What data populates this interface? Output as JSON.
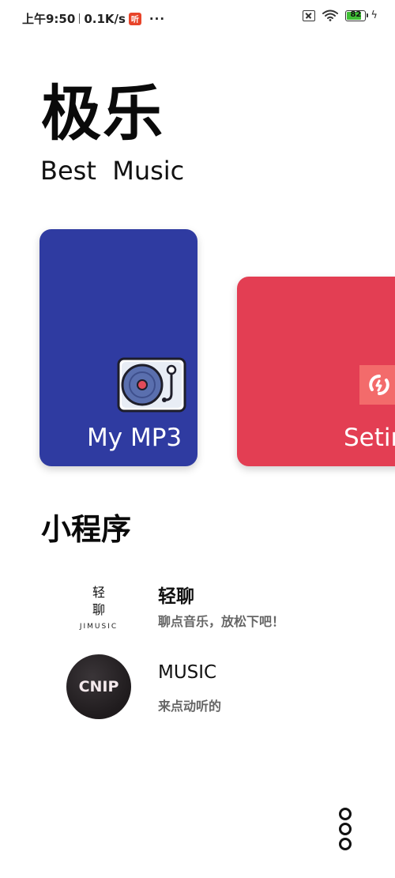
{
  "status_bar": {
    "time": "上午9:50",
    "speed": "0.1K/s",
    "app_icon_glyph": "听",
    "more_dots": "···",
    "battery_level": 82,
    "battery_text": "82",
    "icons": [
      "sim-off-icon",
      "wifi-icon",
      "battery-icon",
      "charging-bolt-icon"
    ]
  },
  "header": {
    "title": "极乐",
    "subtitle": "Best  Music"
  },
  "cards": [
    {
      "label": "My MP3",
      "color": "#2f3ba1",
      "icon": "turntable-icon"
    },
    {
      "label": "Setings",
      "color": "#e33e53",
      "icon": "settings-icon"
    }
  ],
  "section": {
    "title": "小程序"
  },
  "mini_programs": [
    {
      "name": "轻聊",
      "description": "聊点音乐，放松下吧！",
      "logo_line1": "轻",
      "logo_line2": "聊",
      "logo_sub": "JIMUSIC"
    },
    {
      "name": "MUSIC",
      "description": "来点动听的",
      "logo_text": "CNIP"
    }
  ],
  "colors": {
    "mp3_card": "#2f3ba1",
    "settings_card": "#e33e53",
    "battery_fill": "#3fbf35"
  }
}
